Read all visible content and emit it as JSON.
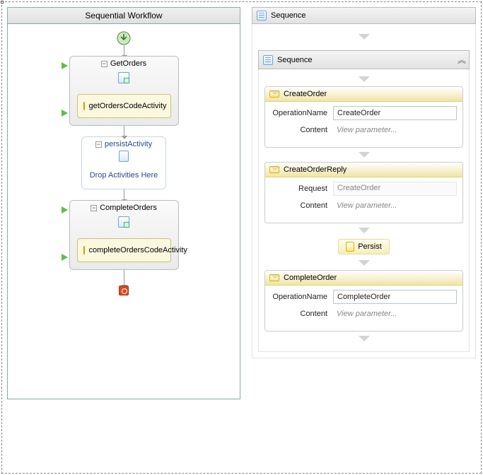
{
  "left": {
    "title": "Sequential Workflow",
    "activities": [
      {
        "title": "GetOrders",
        "inner": "getOrdersCodeActivity"
      },
      {
        "title": "persistActivity",
        "dropText": "Drop Activities Here"
      },
      {
        "title": "CompleteOrders",
        "inner": "completeOrdersCodeActivity"
      }
    ]
  },
  "right": {
    "outerTitle": "Sequence",
    "innerTitle": "Sequence",
    "cards": {
      "createOrder": {
        "title": "CreateOrder",
        "opLabel": "OperationName",
        "opValue": "CreateOrder",
        "contentLabel": "Content",
        "contentValue": "View parameter..."
      },
      "createOrderReply": {
        "title": "CreateOrderReply",
        "reqLabel": "Request",
        "reqValue": "CreateOrder",
        "contentLabel": "Content",
        "contentValue": "View parameter..."
      },
      "persist": {
        "label": "Persist"
      },
      "completeOrder": {
        "title": "CompleteOrder",
        "opLabel": "OperationName",
        "opValue": "CompleteOrder",
        "contentLabel": "Content",
        "contentValue": "View parameter..."
      }
    }
  }
}
